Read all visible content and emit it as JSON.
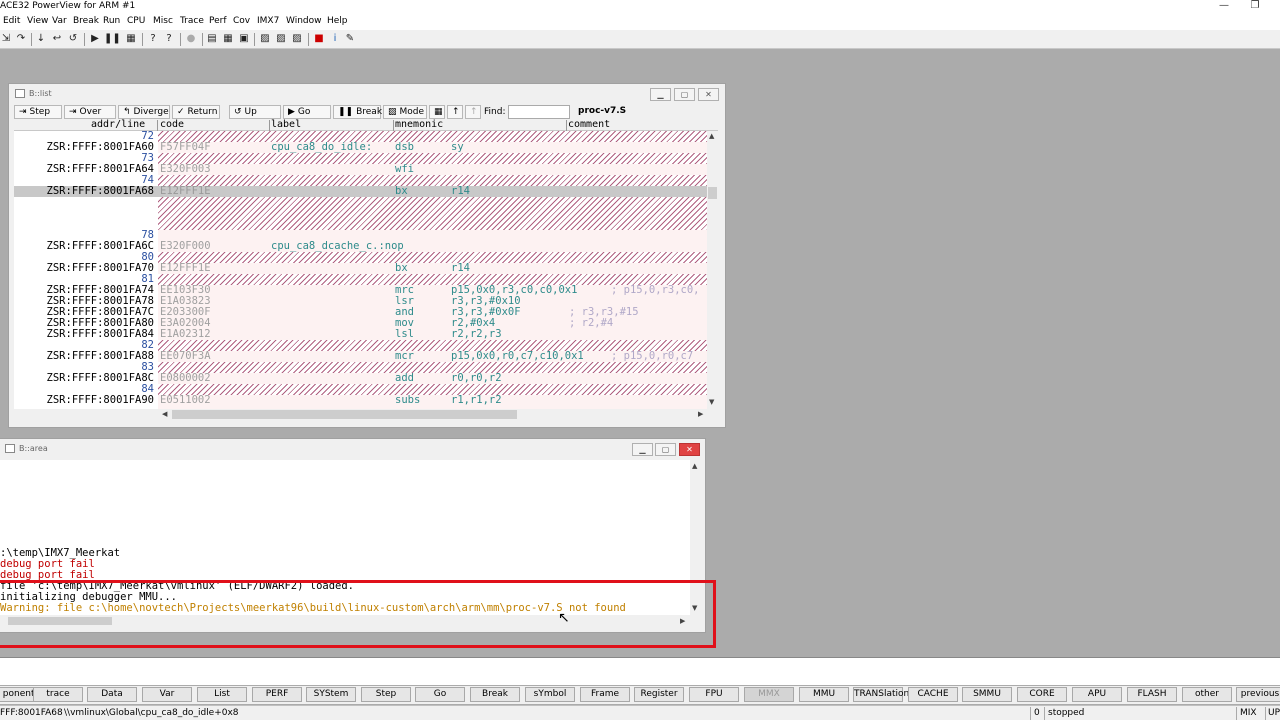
{
  "app": {
    "title": "ACE32 PowerView for ARM #1",
    "win_min": "—",
    "win_max": "❐"
  },
  "menu": [
    "Edit",
    "View",
    "Var",
    "Break",
    "Run",
    "CPU",
    "Misc",
    "Trace",
    "Perf",
    "Cov",
    "IMX7",
    "Window",
    "Help"
  ],
  "list_window": {
    "title": "B::list",
    "toolbar": {
      "step": "Step",
      "over": "Over",
      "diverge": "Diverge",
      "return": "Return",
      "up": "Up",
      "go": "Go",
      "break": "Break",
      "mode": "Mode",
      "find_label": "Find:",
      "find_value": "",
      "filename": "proc-v7.S"
    },
    "columns": {
      "addr": "addr/line",
      "code": "code",
      "label": "label",
      "mnemonic": "mnemonic",
      "comment": "comment"
    },
    "rows": [
      {
        "line": "72"
      },
      {
        "addr": "ZSR:FFFF:8001FA60",
        "code": "F57FF04F",
        "label": "cpu_ca8_do_idle:",
        "mn": "dsb",
        "op": "sy"
      },
      {
        "line": "73"
      },
      {
        "addr": "ZSR:FFFF:8001FA64",
        "code": "E320F003",
        "mn": "wfi"
      },
      {
        "line": "74"
      },
      {
        "addr": "ZSR:FFFF:8001FA68",
        "code": "E12FFF1E",
        "mn": "bx",
        "op": "r14",
        "current": true
      },
      {
        "line": "78"
      },
      {
        "addr": "ZSR:FFFF:8001FA6C",
        "code": "E320F000",
        "label": "cpu_ca8_dcache_c.:nop"
      },
      {
        "line": "80"
      },
      {
        "addr": "ZSR:FFFF:8001FA70",
        "code": "E12FFF1E",
        "mn": "bx",
        "op": "r14"
      },
      {
        "line": "81"
      },
      {
        "addr": "ZSR:FFFF:8001FA74",
        "code": "EE103F30",
        "mn": "mrc",
        "op": "p15,0x0,r3,c0,c0,0x1",
        "comment": "; p15,0,r3,c0,"
      },
      {
        "addr": "ZSR:FFFF:8001FA78",
        "code": "E1A03823",
        "mn": "lsr",
        "op": "r3,r3,#0x10"
      },
      {
        "addr": "ZSR:FFFF:8001FA7C",
        "code": "E203300F",
        "mn": "and",
        "op": "r3,r3,#0x0F",
        "comment": "; r3,r3,#15"
      },
      {
        "addr": "ZSR:FFFF:8001FA80",
        "code": "E3A02004",
        "mn": "mov",
        "op": "r2,#0x4",
        "comment": "; r2,#4"
      },
      {
        "addr": "ZSR:FFFF:8001FA84",
        "code": "E1A02312",
        "mn": "lsl",
        "op": "r2,r2,r3"
      },
      {
        "line": "82"
      },
      {
        "addr": "ZSR:FFFF:8001FA88",
        "code": "EE070F3A",
        "mn": "mcr",
        "op": "p15,0x0,r0,c7,c10,0x1",
        "comment": "; p15,0,r0,c7"
      },
      {
        "line": "83"
      },
      {
        "addr": "ZSR:FFFF:8001FA8C",
        "code": "E0800002",
        "mn": "add",
        "op": "r0,r0,r2"
      },
      {
        "line": "84"
      },
      {
        "addr": "ZSR:FFFF:8001FA90",
        "code": "E0511002",
        "mn": "subs",
        "op": "r1,r1,r2"
      }
    ]
  },
  "area_window": {
    "title": "B::area",
    "lines": [
      {
        "text": ":\\temp\\IMX7_Meerkat",
        "color": "#000000"
      },
      {
        "text": "debug port fail",
        "color": "#c00000"
      },
      {
        "text": "debug port fail",
        "color": "#c00000"
      },
      {
        "text": "file 'c:\\temp\\IMX7_Meerkat\\vmlinux' (ELF/DWARF2) loaded.",
        "color": "#000000"
      },
      {
        "text": "initializing debugger MMU...",
        "color": "#000000"
      },
      {
        "text": "Warning: file c:\\home\\novtech\\Projects\\meerkat96\\build\\linux-custom\\arch\\arm\\mm\\proc-v7.S not found",
        "color": "#c08000"
      }
    ]
  },
  "buttons": [
    "ponents",
    "trace",
    "Data",
    "Var",
    "List",
    "PERF",
    "SYStem",
    "Step",
    "Go",
    "Break",
    "sYmbol",
    "Frame",
    "Register",
    "FPU",
    "MMX",
    "MMU",
    "TRANSlation",
    "CACHE",
    "SMMU",
    "CORE",
    "APU",
    "FLASH",
    "other",
    "previous"
  ],
  "status": {
    "address": "FFF:8001FA68",
    "symbol": "\\\\vmlinux\\Global\\cpu_ca8_do_idle+0x8",
    "count": "0",
    "state": "stopped",
    "mode": "MIX",
    "up": "UP"
  }
}
